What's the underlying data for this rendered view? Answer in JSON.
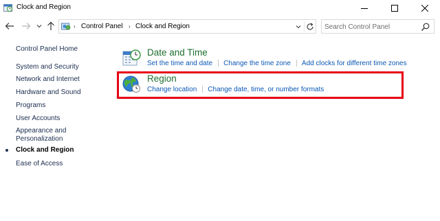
{
  "window": {
    "title": "Clock and Region",
    "icon": "clock-region-icon"
  },
  "nav": {
    "back_icon": "arrow-left-icon",
    "forward_icon": "arrow-right-icon",
    "recent_icon": "chevron-down-icon",
    "up_icon": "arrow-up-icon",
    "breadcrumbs": [
      "Control Panel",
      "Clock and Region"
    ],
    "search": {
      "placeholder": "Search Control Panel",
      "value": ""
    }
  },
  "sidebar": {
    "home": "Control Panel Home",
    "items": [
      "System and Security",
      "Network and Internet",
      "Hardware and Sound",
      "Programs",
      "User Accounts",
      "Appearance and Personalization",
      "Clock and Region",
      "Ease of Access"
    ],
    "current_item": "Clock and Region"
  },
  "categories": [
    {
      "title": "Date and Time",
      "icon": "calendar-clock-icon",
      "links": [
        "Set the time and date",
        "Change the time zone",
        "Add clocks for different time zones"
      ]
    },
    {
      "title": "Region",
      "icon": "globe-clock-icon",
      "links": [
        "Change location",
        "Change date, time, or number formats"
      ]
    }
  ],
  "colors": {
    "category_title": "#1e6f2f",
    "link": "#0b57b5",
    "highlight_border": "#e60012",
    "sidebar_link": "#1b2d4f"
  }
}
